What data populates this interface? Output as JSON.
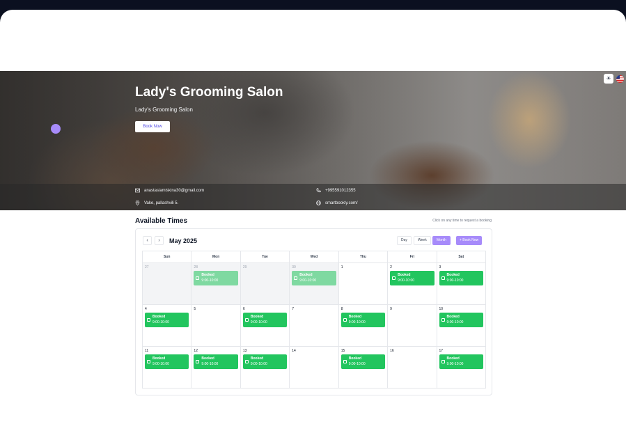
{
  "hero": {
    "title": "Lady's Grooming Salon",
    "subtitle": "Lady's Grooming Salon",
    "book_label": "Book Now",
    "theme_icon": "sun-icon",
    "language_icon": "us-flag-icon",
    "contacts": {
      "email": "anastasiamiskina30@gmail.com",
      "phone": "+995591012355",
      "address": "Vake, pallashvili 5.",
      "website": "smartbookly.com/"
    }
  },
  "calendar": {
    "title": "Available Times",
    "hint": "Click on any time to request a booking",
    "month": "May 2025",
    "prev_label": "‹",
    "next_label": "›",
    "views": [
      "Day",
      "Week",
      "Month"
    ],
    "active_view": "Month",
    "book_label": "+ Book Now",
    "days_of_week": [
      "Sun",
      "Mon",
      "Tue",
      "Wed",
      "Thu",
      "Fri",
      "Sat"
    ],
    "booking_label": "Booked",
    "booking_time": "9:00-10:00",
    "weeks": [
      [
        {
          "day": "27",
          "outside": true,
          "booked": false
        },
        {
          "day": "28",
          "outside": true,
          "booked": true
        },
        {
          "day": "29",
          "outside": true,
          "booked": false
        },
        {
          "day": "30",
          "outside": true,
          "booked": true
        },
        {
          "day": "1",
          "outside": false,
          "booked": false
        },
        {
          "day": "2",
          "outside": false,
          "booked": true
        },
        {
          "day": "3",
          "outside": false,
          "booked": true
        }
      ],
      [
        {
          "day": "4",
          "outside": false,
          "booked": true
        },
        {
          "day": "5",
          "outside": false,
          "booked": false
        },
        {
          "day": "6",
          "outside": false,
          "booked": true
        },
        {
          "day": "7",
          "outside": false,
          "booked": false
        },
        {
          "day": "8",
          "outside": false,
          "booked": true
        },
        {
          "day": "9",
          "outside": false,
          "booked": false
        },
        {
          "day": "10",
          "outside": false,
          "booked": true
        }
      ],
      [
        {
          "day": "11",
          "outside": false,
          "booked": true
        },
        {
          "day": "12",
          "outside": false,
          "booked": true
        },
        {
          "day": "13",
          "outside": false,
          "booked": true
        },
        {
          "day": "14",
          "outside": false,
          "booked": false
        },
        {
          "day": "15",
          "outside": false,
          "booked": true
        },
        {
          "day": "16",
          "outside": false,
          "booked": false
        },
        {
          "day": "17",
          "outside": false,
          "booked": true
        }
      ]
    ]
  },
  "colors": {
    "accent": "#a78bfa",
    "booked": "#22c55e",
    "booked_past": "#7fd9a1"
  }
}
